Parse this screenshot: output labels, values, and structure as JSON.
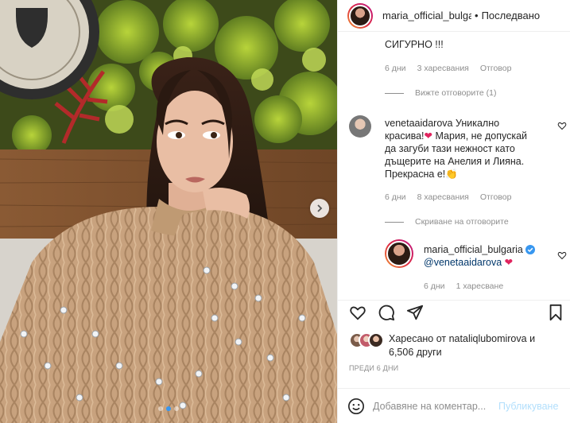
{
  "post": {
    "carousel_active_index": 1,
    "carousel_count": 3
  },
  "header": {
    "username": "maria_official_bulgaria",
    "separator": "•",
    "follow_status": "Последвано"
  },
  "comments": {
    "first": {
      "text": "СИГУРНО !!!",
      "age": "6 дни",
      "likes": "3 харесвания",
      "reply": "Отговор",
      "view_replies": "Вижте отговорите (1)"
    },
    "second": {
      "username": "venetaaidarova",
      "text_line1_pre": "Уникално",
      "text_line2": "красива!",
      "text_line2_post": " Мария, не допускай",
      "text_line3": "да загуби тази нежност като",
      "text_line4": "дъщерите на Анелия и Лияна.",
      "text_line5": "Прекрасна е!",
      "heart_emoji": "❤",
      "clap_emoji": "👏",
      "age": "6 дни",
      "likes": "8 харесвания",
      "reply": "Отговор",
      "hide_replies": "Скриване на отговорите"
    },
    "reply": {
      "username": "maria_official_bulgaria",
      "mention": "@venetaaidarova",
      "heart_emoji": "❤",
      "age": "6 дни",
      "likes": "1 харесване"
    }
  },
  "likes": {
    "prefix": "Харесано от ",
    "user": "nataliqlubomirova",
    "suffix": " и",
    "count_line": "6,506 други"
  },
  "timestamp": "ПРЕДИ 6 ДНИ",
  "add_comment": {
    "placeholder": "Добавяне на коментар...",
    "post_label": "Публикуване"
  },
  "colors": {
    "link_blue": "#3897f0",
    "post_disabled": "#b2dffc",
    "heart_red": "#e0245e",
    "verified": "#3897f0"
  }
}
